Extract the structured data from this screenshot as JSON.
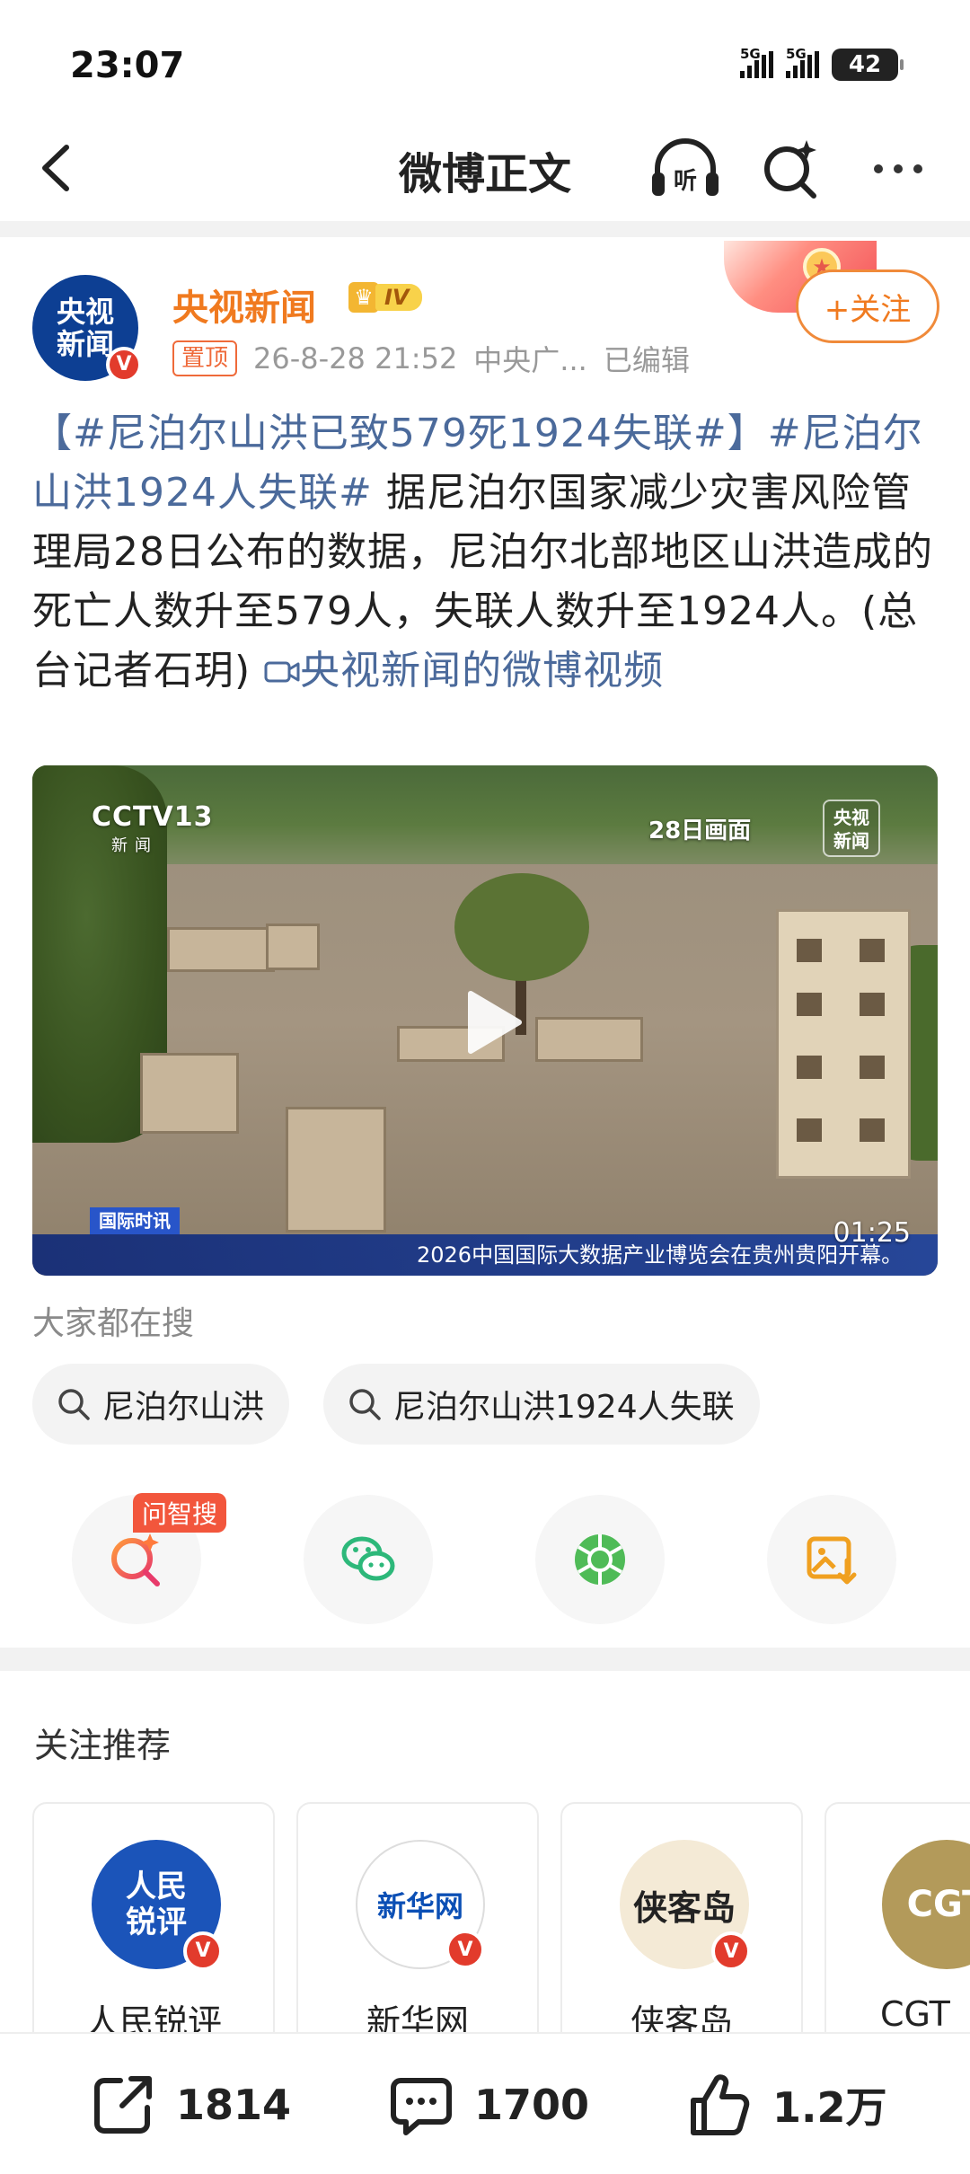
{
  "status_bar": {
    "time": "23:07",
    "signal1": "5G",
    "signal2": "5G",
    "battery": "42"
  },
  "nav": {
    "title": "微博正文",
    "listen_label": "听"
  },
  "post": {
    "author": {
      "name": "央视新闻",
      "avatar_line1": "央视",
      "avatar_line2": "新闻",
      "level": "IV",
      "verified": "V"
    },
    "pin_label": "置顶",
    "time": "26-8-28 21:52",
    "source": "中央广...",
    "edited": "已编辑",
    "follow_label": "+关注",
    "text": {
      "tag1": "【#尼泊尔山洪已致579死1924失联#】",
      "tag2": "#尼泊尔山洪1924人失联#",
      "body": " 据尼泊尔国家减少灾害风险管理局28日公布的数据，尼泊尔北部地区山洪造成的死亡人数升至579人，失联人数升至1924人。(总台记者石玥) ",
      "video_link": "央视新闻的微博视频"
    },
    "video": {
      "channel_logo": "CCTV13",
      "channel_sub": "新闻",
      "date_tag": "28日画面",
      "corner_logo_1": "央视",
      "corner_logo_2": "新闻",
      "program_tag": "国际时讯",
      "ticker": "2026中国国际大数据产业博览会在贵州贵阳开幕。",
      "duration": "01:25"
    }
  },
  "hot_search": {
    "title": "大家都在搜",
    "chips": [
      "尼泊尔山洪",
      "尼泊尔山洪1924人失联"
    ]
  },
  "share": {
    "wenzhisou_tag": "问智搜"
  },
  "recommend": {
    "title": "关注推荐",
    "items": [
      {
        "name": "人民锐评",
        "logo": "人民锐评"
      },
      {
        "name": "新华网",
        "logo": "新华网"
      },
      {
        "name": "侠客岛",
        "logo": "侠客岛"
      },
      {
        "name": "CGT",
        "logo": "CGT"
      }
    ]
  },
  "bottom_bar": {
    "reposts": "1814",
    "comments": "1700",
    "likes": "1.2万"
  },
  "colors": {
    "brand_orange": "#f07a1f",
    "link_blue": "#4b6a9b",
    "verified_red": "#e23b2c"
  }
}
